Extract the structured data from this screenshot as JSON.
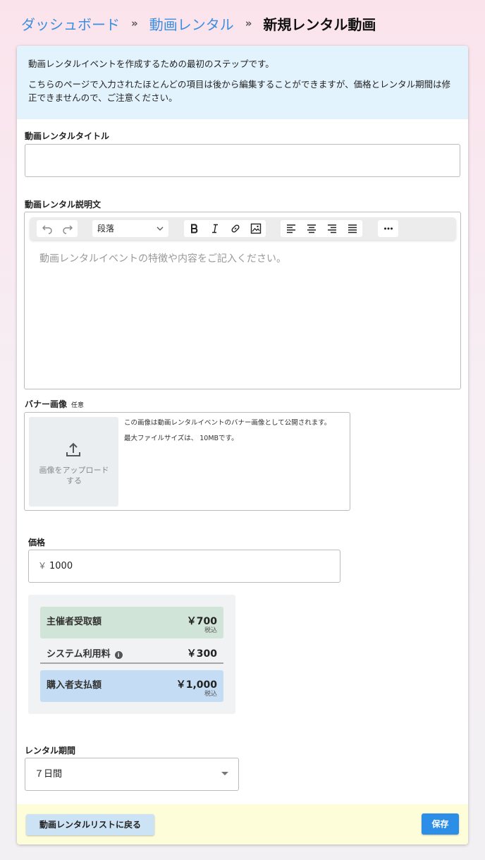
{
  "breadcrumb": {
    "items": [
      "ダッシュボード",
      "動画レンタル"
    ],
    "separator": "»",
    "current": "新規レンタル動画"
  },
  "notice": {
    "line1": "動画レンタルイベントを作成するための最初のステップです。",
    "line2": "こちらのページで入力されたほとんどの項目は後から編集することができますが、価格とレンタル期間は修正できませんので、ご注意ください。"
  },
  "title_field": {
    "label": "動画レンタルタイトル",
    "value": ""
  },
  "description_field": {
    "label": "動画レンタル説明文",
    "placeholder": "動画レンタルイベントの特徴や内容をご記入ください。",
    "format_select": "段落",
    "toolbar_icons": [
      "undo-icon",
      "redo-icon",
      "bold-icon",
      "italic-icon",
      "link-icon",
      "image-icon",
      "align-left-icon",
      "align-center-icon",
      "align-right-icon",
      "align-justify-icon",
      "more-icon"
    ]
  },
  "banner": {
    "label": "バナー画像",
    "optional": "任意",
    "upload_text": "画像をアップロードする",
    "info1": "この画像は動画レンタルイベントのバナー画像として公開されます。",
    "info2": "最大ファイルサイズは、 10MBです。"
  },
  "price": {
    "label": "価格",
    "currency": "￥",
    "value": "1000"
  },
  "breakdown": {
    "organizer": {
      "label": "主催者受取額",
      "amount": "￥700",
      "note": "税込"
    },
    "fee": {
      "label": "システム利用料",
      "amount": "￥300",
      "info": "i"
    },
    "buyer": {
      "label": "購入者支払額",
      "amount": "￥1,000",
      "note": "税込"
    }
  },
  "period": {
    "label": "レンタル期間",
    "value": "７日間"
  },
  "footer": {
    "back_label": "動画レンタルリストに戻る",
    "save_label": "保存"
  },
  "colors": {
    "accent": "#2c8ee6",
    "link": "#3a8fe0",
    "notice_bg": "#e3f3fd",
    "footer_bg": "#fefdda",
    "organizer_bg": "#d0e4d7",
    "buyer_bg": "#c5ddf4"
  }
}
